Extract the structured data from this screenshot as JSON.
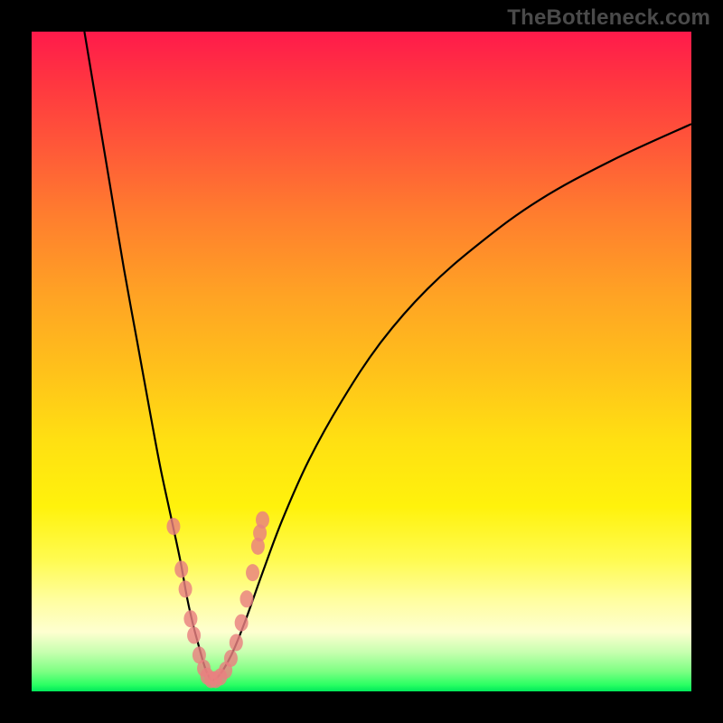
{
  "watermark": "TheBottleneck.com",
  "chart_data": {
    "type": "line",
    "title": "",
    "xlabel": "",
    "ylabel": "",
    "xlim": [
      0,
      100
    ],
    "ylim": [
      0,
      100
    ],
    "note": "Axes are unlabeled in the source image; values are normalized 0–100 estimates read from pixel positions.",
    "series": [
      {
        "name": "left-curve",
        "x": [
          8,
          10,
          12,
          14,
          16,
          18,
          19.5,
          21,
          22.5,
          23.6,
          24.5,
          25.3,
          26,
          26.5,
          27,
          27.3
        ],
        "values": [
          100,
          88,
          76,
          64,
          53,
          42,
          34,
          27,
          20,
          14,
          10,
          7,
          4.5,
          3,
          2,
          1.6
        ]
      },
      {
        "name": "right-curve",
        "x": [
          27.3,
          28,
          29,
          30.5,
          32.5,
          35,
          38,
          42,
          47,
          53,
          60,
          68,
          77,
          88,
          100
        ],
        "values": [
          1.6,
          2,
          3.2,
          6,
          11,
          18,
          26,
          35,
          44,
          53,
          61,
          68,
          74.5,
          80.5,
          86
        ]
      }
    ],
    "highlight_dots": {
      "name": "dotted-overlay",
      "x": [
        21.5,
        22.7,
        23.3,
        24.1,
        24.6,
        25.4,
        26.1,
        26.6,
        27.2,
        27.9,
        28.6,
        29.4,
        30.2,
        31.0,
        31.8,
        32.6,
        33.5,
        34.3,
        34.6,
        35.0
      ],
      "values": [
        25,
        18.5,
        15.5,
        11,
        8.5,
        5.5,
        3.5,
        2.3,
        1.8,
        1.8,
        2.2,
        3.2,
        5,
        7.4,
        10.4,
        14,
        18,
        22,
        24,
        26
      ]
    }
  }
}
